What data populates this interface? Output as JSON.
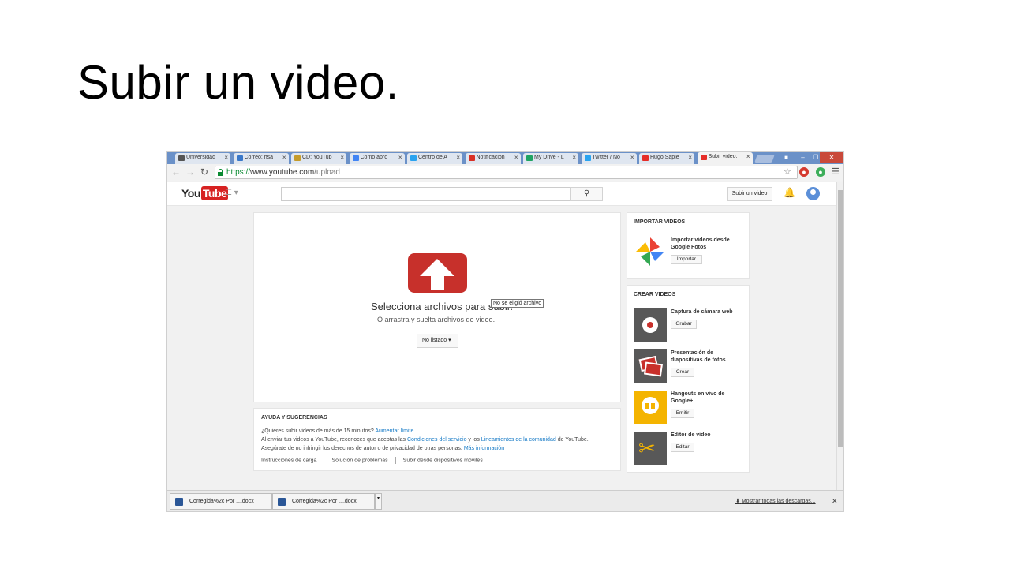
{
  "slide": {
    "title": "Subir un video."
  },
  "browser": {
    "tabs": [
      {
        "label": "Universidad",
        "icon": "eye-icon",
        "color": "#555555"
      },
      {
        "label": "Correo: hsa",
        "icon": "mail-icon",
        "color": "#3a78c9"
      },
      {
        "label": "CD: YouTub",
        "icon": "folder-icon",
        "color": "#c59b2a"
      },
      {
        "label": "Cómo apro",
        "icon": "google-icon",
        "color": "#4285f4"
      },
      {
        "label": "Centro de A",
        "icon": "twitter-icon",
        "color": "#2aa3ef"
      },
      {
        "label": "Notificación",
        "icon": "gmail-icon",
        "color": "#d93025"
      },
      {
        "label": "My Drive - L",
        "icon": "drive-icon",
        "color": "#1fa463"
      },
      {
        "label": "Twitter / No",
        "icon": "twitter-icon",
        "color": "#2aa3ef"
      },
      {
        "label": "Hugo Sapie",
        "icon": "youtube-icon",
        "color": "#e52d27"
      },
      {
        "label": "Subir video:",
        "icon": "youtube-icon",
        "color": "#e52d27",
        "active": true
      }
    ],
    "url_scheme": "https://",
    "url_host": "www.youtube.com",
    "url_path": "/upload"
  },
  "youtube": {
    "logo_you": "You",
    "logo_tube": "Tube",
    "search_placeholder": "",
    "upload_button": "Subir un video",
    "upload": {
      "select_files": "Selecciona archivos para subir.",
      "no_file_tooltip": "No se eligió archivo",
      "drag_text": "O arrastra y suelta archivos de video.",
      "privacy_value": "No listado"
    },
    "help": {
      "title": "AYUDA Y SUGERENCIAS",
      "line1_text": "¿Quieres subir videos de más de 15 minutos?",
      "line1_link": "Aumentar límite",
      "line2_a": "Al enviar tus videos a YouTube, reconoces que aceptas las",
      "line2_link1": "Condiciones del servicio",
      "line2_b": "y los",
      "line2_link2": "Lineamientos de la comunidad",
      "line2_c": "de YouTube.",
      "line3_text": "Asegúrate de no infringir los derechos de autor o de privacidad de otras personas.",
      "line3_link": "Más información",
      "links": [
        "Instrucciones de carga",
        "Solución de problemas",
        "Subir desde dispositivos móviles"
      ]
    },
    "import": {
      "title": "IMPORTAR VIDEOS",
      "item_label": "Importar videos desde Google Fotos",
      "item_button": "Importar"
    },
    "create": {
      "title": "CREAR VIDEOS",
      "items": [
        {
          "label": "Captura de cámara web",
          "button": "Grabar",
          "icon": "webcam-record-icon"
        },
        {
          "label": "Presentación de diapositivas de fotos",
          "button": "Crear",
          "icon": "slideshow-icon"
        },
        {
          "label": "Hangouts en vivo de Google+",
          "button": "Emitir",
          "icon": "hangouts-icon"
        },
        {
          "label": "Editor de video",
          "button": "Editar",
          "icon": "scissors-icon"
        }
      ]
    }
  },
  "downloads": {
    "items": [
      "Corregida%2c Por ....docx",
      "Corregida%2c Por ....docx"
    ],
    "show_all": "Mostrar todas las descargas..."
  }
}
